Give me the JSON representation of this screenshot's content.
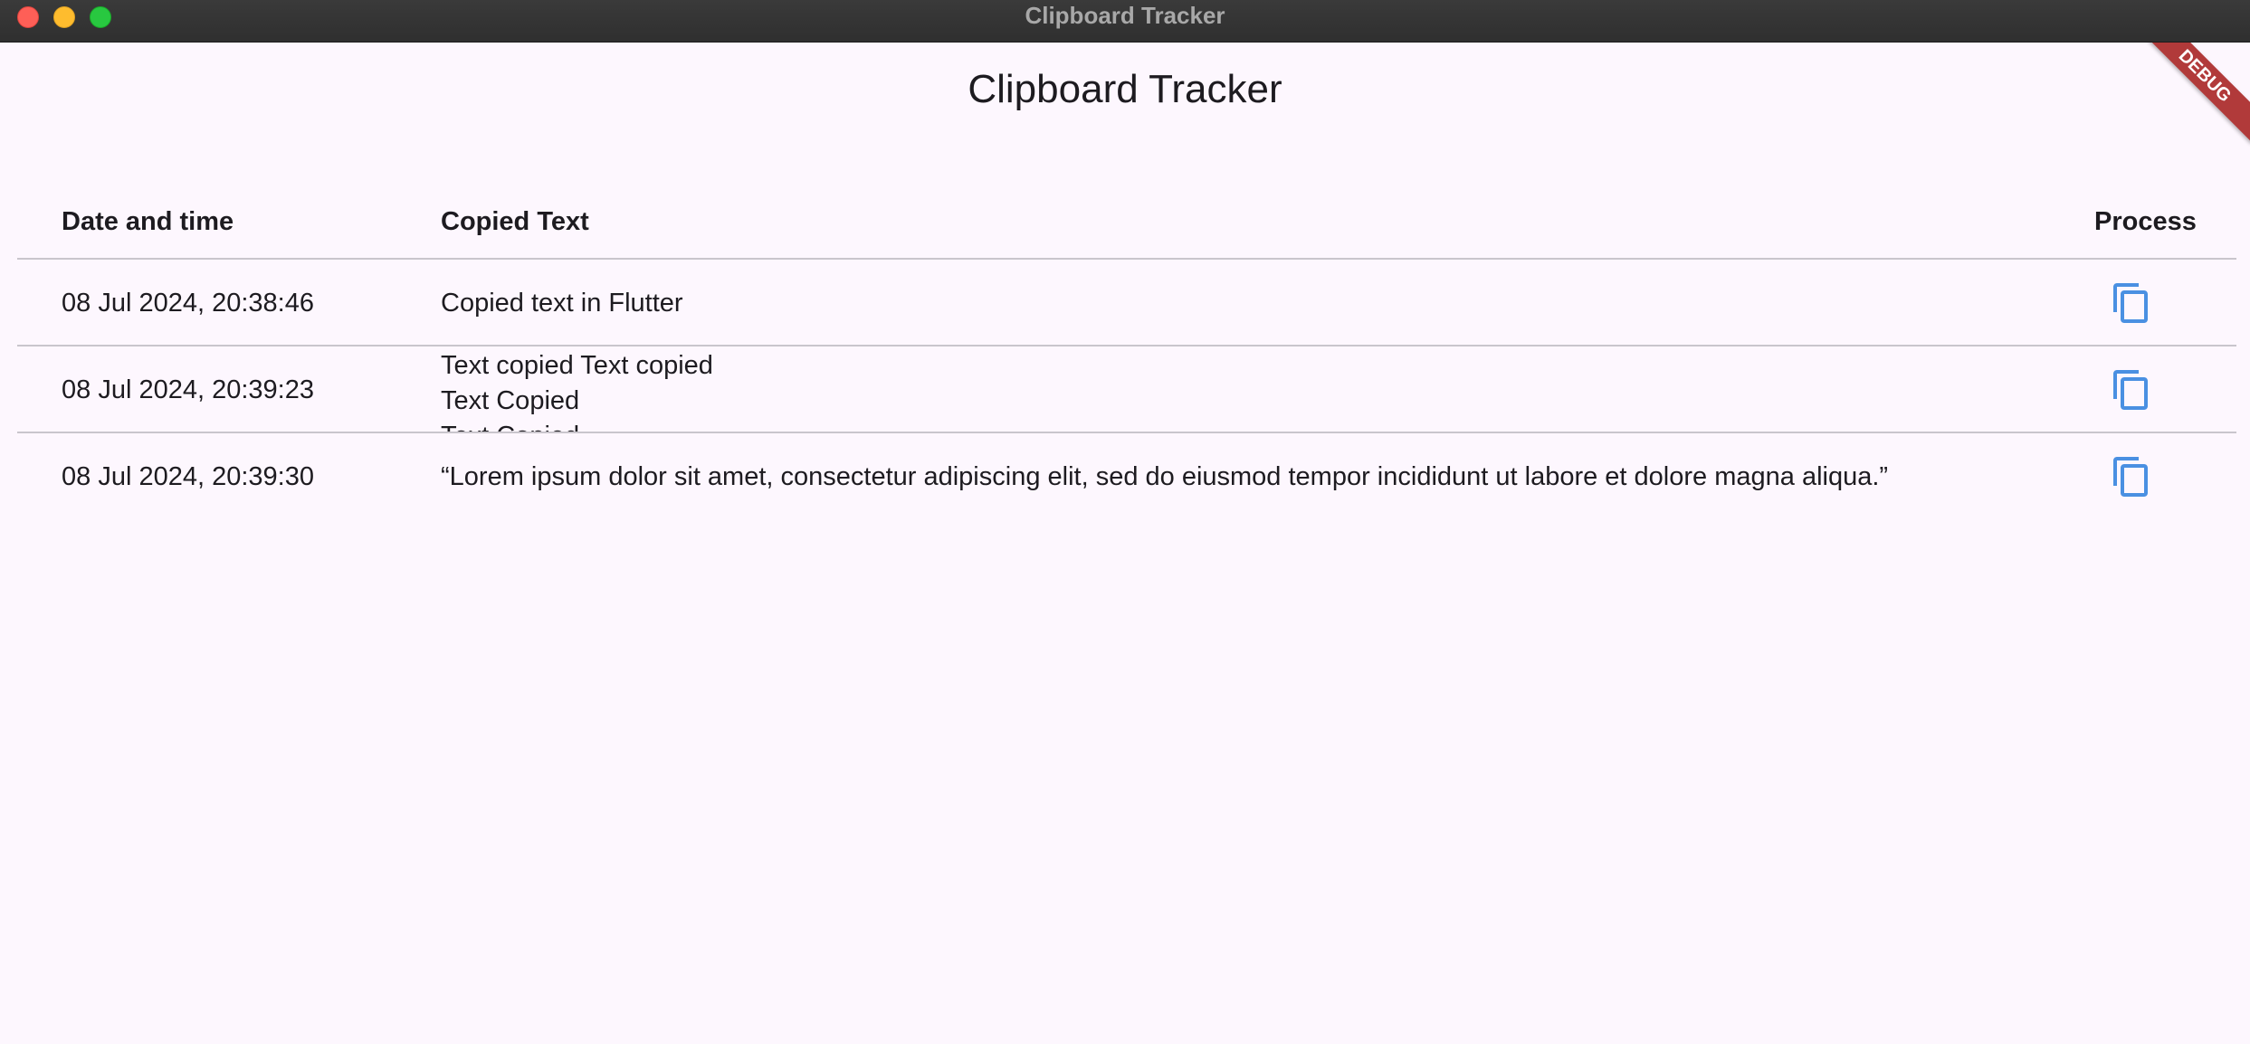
{
  "window": {
    "title": "Clipboard Tracker"
  },
  "app": {
    "title": "Clipboard Tracker",
    "debug_banner": "DEBUG"
  },
  "table": {
    "headers": {
      "date": "Date and time",
      "text": "Copied Text",
      "process": "Process"
    },
    "rows": [
      {
        "date": "08 Jul 2024, 20:38:46",
        "text": "Copied text in Flutter"
      },
      {
        "date": "08 Jul 2024, 20:39:23",
        "text": "Text copied Text copied\nText Copied\nText Copied"
      },
      {
        "date": "08 Jul 2024, 20:39:30",
        "text": "“Lorem ipsum dolor sit amet, consectetur adipiscing elit, sed do eiusmod tempor incididunt ut labore et dolore magna aliqua.”"
      }
    ]
  },
  "colors": {
    "accent": "#4a90e2",
    "background": "#fdf7fe",
    "divider": "#c9c5cc",
    "debug": "#b13a3a"
  },
  "icons": {
    "copy": "copy-icon"
  }
}
